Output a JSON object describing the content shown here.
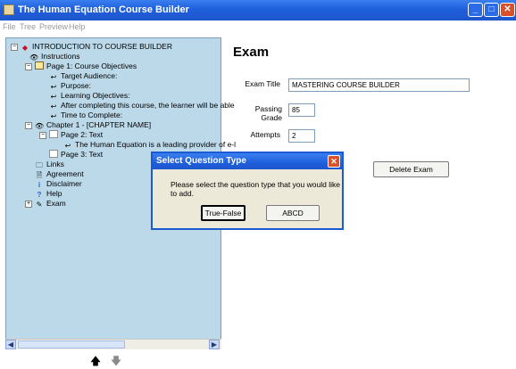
{
  "window": {
    "title": "The Human Equation Course Builder"
  },
  "menu": [
    "File",
    "Tree",
    "Preview",
    "Help"
  ],
  "tree": {
    "root": "INTRODUCTION TO COURSE BUILDER",
    "instructions": "Instructions",
    "page1": "Page 1: Course Objectives",
    "target_audience": "Target Audience:",
    "purpose": "Purpose:",
    "learning_objectives": "Learning Objectives:",
    "after_completing": "After completing this course, the learner will be able",
    "time_to_complete": "Time to Complete:",
    "chapter1": "Chapter 1 - [CHAPTER NAME]",
    "page2": "Page 2: Text",
    "human_equation": "The Human Equation is a leading provider of e-l",
    "page3": "Page 3: Text",
    "links": "Links",
    "agreement": "Agreement",
    "disclaimer": "Disclaimer",
    "help": "Help",
    "exam": "Exam"
  },
  "main": {
    "heading": "Exam",
    "exam_title_label": "Exam Title",
    "exam_title_value": "MASTERING COURSE BUILDER",
    "passing_grade_label": "Passing Grade",
    "passing_grade_value": "85",
    "attempts_label": "Attempts",
    "attempts_value": "2",
    "delete_exam_label": "Delete Exam"
  },
  "dialog": {
    "title": "Select Question Type",
    "message": "Please select the question type that you would like to add.",
    "true_false_label": "True-False",
    "abcd_label": "ABCD"
  },
  "colors": {
    "titlebar": "#1f5fdb",
    "tree_background": "#bcd9ea",
    "dialog_background": "#ece9d8",
    "close_button": "#d9502b"
  },
  "icons": {
    "root": "red-diamond-icon",
    "instructions": "eye-icon",
    "page": "page-icon",
    "item": "arrow-return-icon",
    "chapter": "eye-icon",
    "links": "folder-icon",
    "agreement": "document-check-icon",
    "disclaimer": "info-icon",
    "help": "help-icon",
    "exam": "pencil-icon",
    "up": "up-arrow-icon",
    "down": "down-arrow-icon"
  }
}
